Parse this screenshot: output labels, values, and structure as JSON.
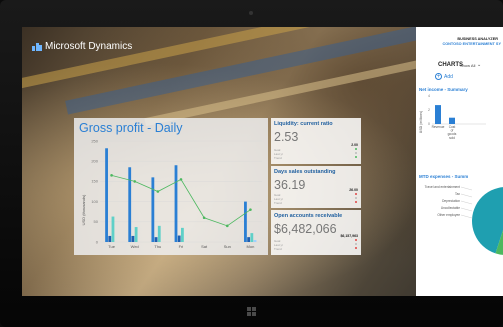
{
  "app": {
    "logo_text": "Microsoft Dynamics",
    "app_title": "BUSINESS ANALYZER",
    "company": "CONTOSO ENTERTAINMENT SY"
  },
  "gross_profit": {
    "title": "Gross profit - Daily",
    "ylabel": "USD (thousands)",
    "yticks": [
      "250",
      "200",
      "150",
      "100",
      "50",
      "0"
    ],
    "chart_data": {
      "type": "bar",
      "categories": [
        "Tue",
        "Wed",
        "Thu",
        "Fri",
        "Sat",
        "Sun",
        "Mon"
      ],
      "ylim": [
        0,
        250
      ],
      "series": [
        {
          "values": [
            232,
            185,
            160,
            190,
            0,
            0,
            100
          ],
          "color": "#2a7fd4"
        },
        {
          "values": [
            15,
            15,
            12,
            16,
            0,
            0,
            12
          ],
          "color": "#1f5fb0"
        },
        {
          "values": [
            63,
            37,
            40,
            35,
            0,
            0,
            22
          ],
          "color": "#5fd0c8"
        },
        {
          "values": [
            0,
            0,
            0,
            0,
            0,
            0,
            5
          ],
          "color": "#9fd1ff"
        }
      ],
      "line": {
        "values": [
          165,
          150,
          125,
          155,
          60,
          40,
          80
        ],
        "color": "#4cb85f"
      }
    }
  },
  "kpis": [
    {
      "title": "Liquidity: current ratio",
      "value": "2.53",
      "side_value": "2.00",
      "rows": [
        "Goal",
        "Last yr",
        "Trend"
      ],
      "dots": [
        "#4cb85f",
        "#bbbbbb",
        "#4cb85f"
      ]
    },
    {
      "title": "Days sales outstanding",
      "value": "36.19",
      "side_value": "26.00",
      "rows": [
        "Goal",
        "Last yr",
        "Trend"
      ],
      "dots": [
        "#e04444",
        "#bbbbbb",
        "#e04444"
      ]
    },
    {
      "title": "Open accounts receivable",
      "value": "$6,482,066",
      "side_value": "$6,157,963",
      "rows": [
        "Goal",
        "Last yr",
        "Trend"
      ],
      "dots": [
        "#e04444",
        "#bbbbbb",
        "#e04444"
      ]
    }
  ],
  "charts_panel": {
    "header": "CHARTS",
    "filter_label": "Show All",
    "add_label": "Add",
    "net_income": {
      "title": "Net income - Summary",
      "ylabel": "USD (millions)",
      "yticks": [
        "4",
        "2",
        "0"
      ],
      "chart_data": {
        "type": "bar",
        "categories": [
          "Revenue",
          "Cost of goods sold"
        ],
        "values": [
          2.7,
          0.9
        ],
        "ylim": [
          0,
          4
        ]
      }
    },
    "mtd_expenses": {
      "title": "MTD expenses - Summ",
      "chart_data": {
        "type": "pie",
        "labels": [
          "Travel and entertainment",
          "Tax",
          "Depreciation",
          "Uncollectable",
          "Other employee"
        ]
      }
    }
  }
}
